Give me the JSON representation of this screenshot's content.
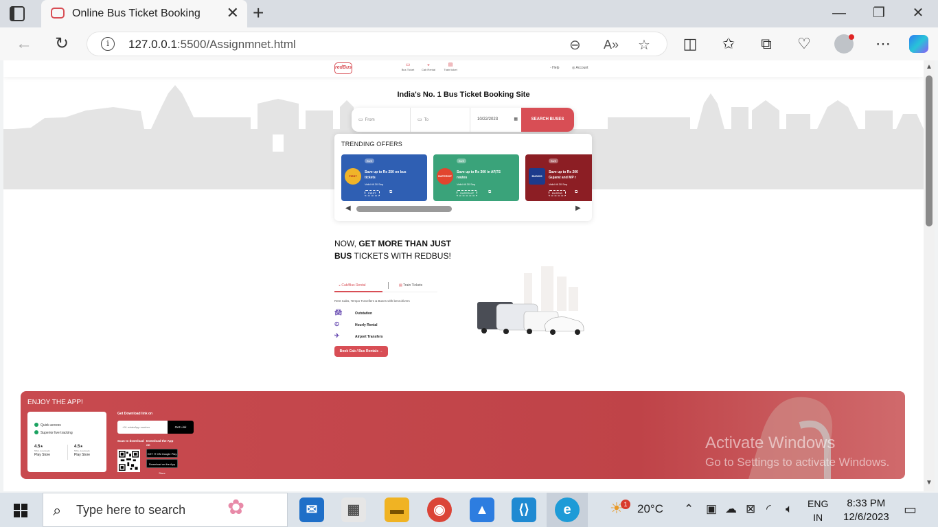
{
  "browser": {
    "tab_title": "Online Bus Ticket Booking",
    "url_host": "127.0.0.1",
    "url_path": ":5500/Assignmnet.html"
  },
  "site": {
    "logo": "redBus",
    "nav": [
      "Bus Ticket",
      "Cab Rental",
      "Train ticket"
    ],
    "help": "Help",
    "account": "Account"
  },
  "hero": {
    "title": "India's No. 1 Bus Ticket Booking Site",
    "from_placeholder": "From",
    "to_placeholder": "To",
    "date": "10/22/2023",
    "search_button": "SEARCH BUSES"
  },
  "offers": {
    "title": "TRENDING OFFERS",
    "items": [
      {
        "tag": "BUS",
        "badge": "FIRST",
        "text_line1": "Save up to Rs 250 on bus",
        "text_line2": "tickets",
        "valid": "Valid till 30 Sep",
        "code": "FIRST",
        "color": "#2f5fb3"
      },
      {
        "tag": "BUS",
        "badge": "SUPERHIT",
        "text_line1": "Save up to Rs 300 in AP,TS",
        "text_line2": "routes",
        "valid": "Valid till 30 Sep",
        "code": "SUPERHIT",
        "color": "#3aa37a"
      },
      {
        "tag": "BUS",
        "badge": "BUS200",
        "text_line1": "Save up to Rs 200",
        "text_line2": "Gujarat and MP r",
        "valid": "Valid till 30 Sep",
        "code": "BUS200",
        "color": "#8c1e24"
      }
    ]
  },
  "rental": {
    "heading_1": "NOW, ",
    "heading_2": "GET MORE THAN JUST BUS",
    "heading_3": " TICKETS WITH REDBUS!",
    "tab_cab": "Cab/Bus Rental",
    "tab_train": "Train Tickets",
    "description": "Rent Cabs, Tempo Travellers & Buses with best drivers",
    "items": [
      "Outstation",
      "Hourly Rental",
      "Airport Transfers"
    ],
    "cta": "Book Cab / Bus Rentals"
  },
  "app": {
    "title": "ENJOY THE APP!",
    "features": [
      "Quick access",
      "Superior live tracking"
    ],
    "ratings": [
      {
        "score": "4.5",
        "sub": "50M+ downloads",
        "store": "Play Store"
      },
      {
        "score": "4.5",
        "sub": "50M+ downloads",
        "store": "Play Store"
      }
    ],
    "download_title": "Get Download link on",
    "input_placeholder": "whatsApp number",
    "get_link": "Get Link",
    "scan_label": "Scan to download",
    "download_label": "Download the App on",
    "google_play": "GET IT ON Google Play",
    "app_store": "Download on the App Store"
  },
  "watermark": {
    "title": "Activate Windows",
    "subtitle": "Go to Settings to activate Windows."
  },
  "taskbar": {
    "search_placeholder": "Type here to search",
    "temperature": "20°C",
    "language_1": "ENG",
    "language_2": "IN",
    "time": "8:33 PM",
    "date": "12/6/2023",
    "notification_count": "1"
  }
}
